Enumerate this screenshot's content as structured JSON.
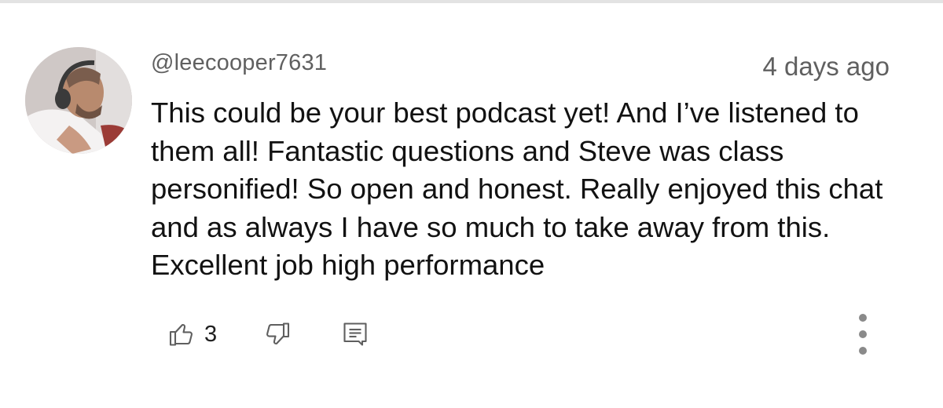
{
  "comment": {
    "username": "@leecooper7631",
    "timestamp": "4 days ago",
    "text": "This could be your best podcast yet! And I’ve listened to them all! Fantastic questions and Steve was class personified! So open and honest. Really enjoyed this chat and as always I have so much to take away from this. Excellent job high performance",
    "like_count": "3",
    "icons": {
      "like": "thumbs-up-icon",
      "dislike": "thumbs-down-icon",
      "reply": "reply-icon",
      "more": "more-vertical-icon"
    }
  },
  "colors": {
    "meta_text": "#606060",
    "body_text": "#121212",
    "icon": "#5f5f5f"
  }
}
